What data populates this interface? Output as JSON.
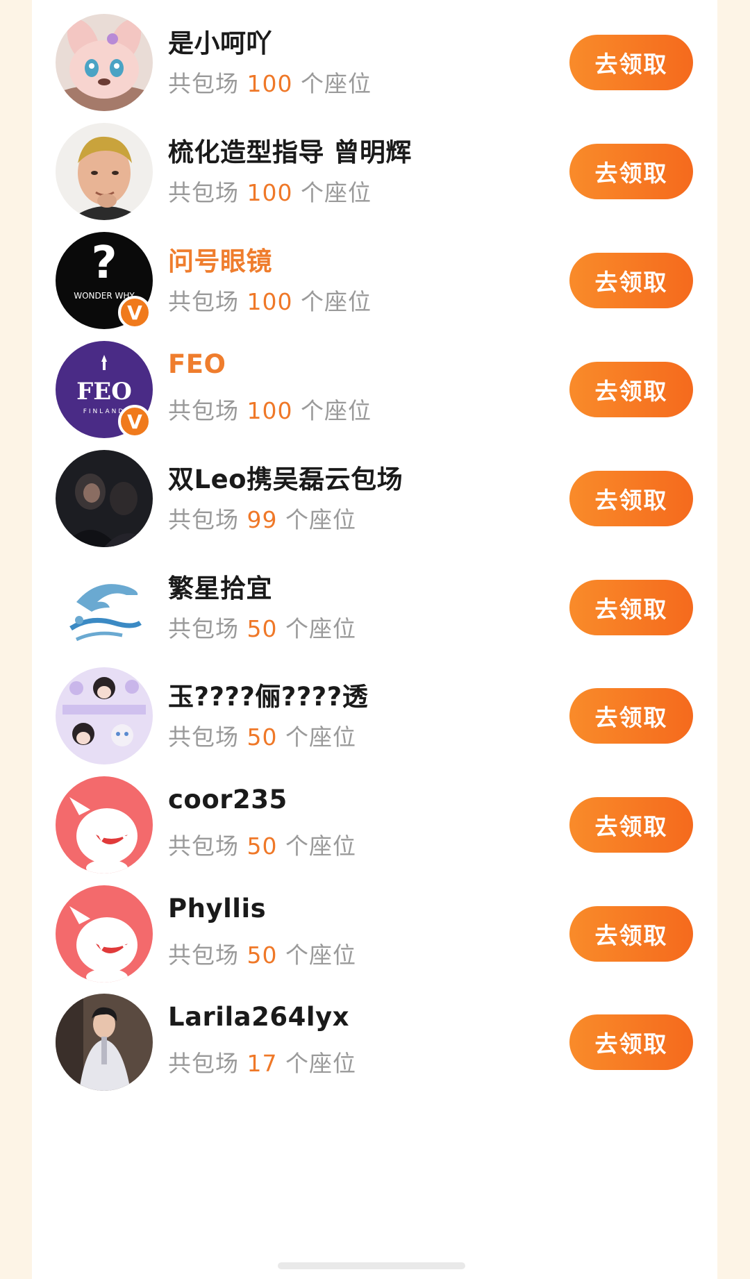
{
  "list": {
    "seats_prefix": "共包场",
    "seats_suffix": "个座位",
    "button_label": "去领取",
    "items": [
      {
        "name": "是小呵吖",
        "seats": "100",
        "verified": false,
        "avatar": "plush-bunny-avatar"
      },
      {
        "name": "梳化造型指导 曾明辉",
        "seats": "100",
        "verified": false,
        "avatar": "man-portrait-avatar"
      },
      {
        "name": "问号眼镜",
        "seats": "100",
        "verified": true,
        "avatar": "wonder-why-logo-avatar",
        "avatar_text": "WONDER WHY"
      },
      {
        "name": "FEO",
        "seats": "100",
        "verified": true,
        "avatar": "feo-logo-avatar",
        "avatar_text": "FEO",
        "avatar_subtext": "FINLAND"
      },
      {
        "name": "双Leo携吴磊云包场",
        "seats": "99",
        "verified": false,
        "avatar": "dark-photo-avatar"
      },
      {
        "name": "繁星拾宜",
        "seats": "50",
        "verified": false,
        "avatar": "dolphin-avatar"
      },
      {
        "name": "玉????俪????透",
        "seats": "50",
        "verified": false,
        "avatar": "cartoon-collage-avatar"
      },
      {
        "name": "coor235",
        "seats": "50",
        "verified": false,
        "avatar": "default-mascot-avatar"
      },
      {
        "name": "Phyllis",
        "seats": "50",
        "verified": false,
        "avatar": "default-mascot-avatar"
      },
      {
        "name": "Larila264lyx",
        "seats": "17",
        "verified": false,
        "avatar": "man-in-white-coat-avatar"
      }
    ]
  },
  "colors": {
    "accent": "#f07a1c",
    "verified_name": "#ef7d2d",
    "seat_number": "#ef7828",
    "page_background": "#fdf4e6"
  }
}
